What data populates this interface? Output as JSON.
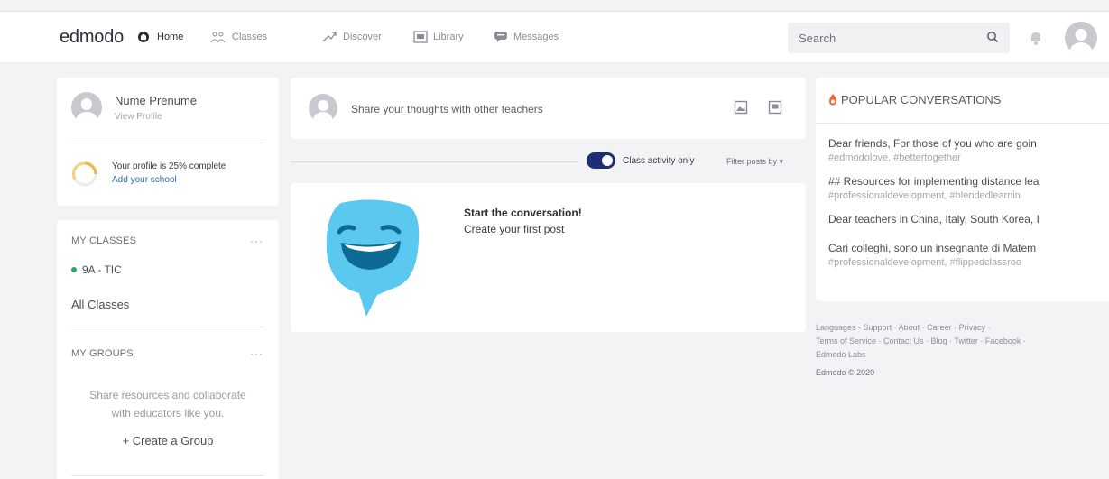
{
  "brand": {
    "logo": "edmodo"
  },
  "nav": [
    {
      "label": "Home",
      "icon": "home-icon",
      "active": true
    },
    {
      "label": "Classes",
      "icon": "classes-icon",
      "active": false
    },
    {
      "label": "Discover",
      "icon": "discover-icon",
      "active": false
    },
    {
      "label": "Library",
      "icon": "library-icon",
      "active": false
    },
    {
      "label": "Messages",
      "icon": "messages-icon",
      "active": false
    }
  ],
  "search": {
    "placeholder": "Search"
  },
  "profile": {
    "name": "Nume Prenume",
    "link": "View Profile",
    "completion_text": "Your profile is 25% complete",
    "completion_percent": 25,
    "add_school": "Add your school"
  },
  "classes": {
    "title": "MY CLASSES",
    "items": [
      {
        "label": "9A - TIC",
        "color": "#30a36b"
      }
    ],
    "all": "All Classes"
  },
  "groups": {
    "title": "MY GROUPS",
    "description_line1": "Share resources and collaborate",
    "description_line2": "with educators like you.",
    "create": "+ Create a Group"
  },
  "composer": {
    "placeholder": "Share your thoughts with other teachers"
  },
  "filters": {
    "toggle_label": "Class activity only",
    "toggle_on": true,
    "filter_label": "Filter posts by ▾"
  },
  "empty_feed": {
    "title": "Start the conversation!",
    "subtitle": "Create your first post"
  },
  "popular": {
    "title": "POPULAR CONVERSATIONS",
    "items": [
      {
        "text": "Dear friends, For those of you who are goin",
        "tags": "#edmodolove, #bettertogether"
      },
      {
        "text": "## Resources for implementing distance lea",
        "tags": "#professionaldevelopment, #blendedlearnin"
      },
      {
        "text": "Dear teachers in China, Italy, South Korea, I",
        "tags": ""
      },
      {
        "text": "Cari colleghi, sono un insegnante di Matem",
        "tags": "#professionaldevelopment, #flippedclassroo"
      }
    ]
  },
  "footer": {
    "line1": "Languages · Support · About · Career · Privacy ·",
    "line2": "Terms of Service · Contact Us · Blog · Twitter · Facebook ·",
    "line3": "Edmodo Labs",
    "copyright": "Edmodo © 2020"
  },
  "colors": {
    "accent": "#1c2f74",
    "link": "#2b6db5",
    "mascot": "#5bc8ef",
    "flame": "#f06a3c"
  }
}
